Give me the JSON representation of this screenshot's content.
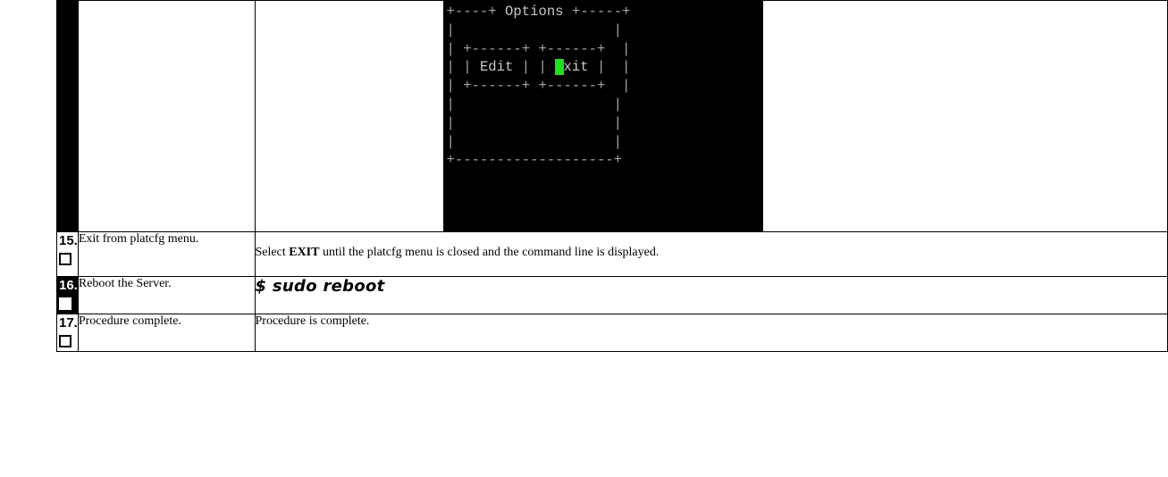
{
  "rows": [
    {
      "step": "",
      "description": "",
      "terminal": {
        "line1_pre": "+----+ ",
        "title": "Options",
        "line1_post": " +-----+",
        "blank": "|                   |",
        "btn_border": "| +------+ +------+  |",
        "btn_line_pre": "| | ",
        "edit_label": "Edit",
        "btn_mid": " | | ",
        "exit_cursor": "E",
        "exit_rest": "xit",
        "btn_line_post": " |  |",
        "bottom": "+-------------------+"
      }
    },
    {
      "step": "15.",
      "description": "Exit from platcfg menu.",
      "body_pre": "Select ",
      "body_bold": "EXIT",
      "body_post": " until the platcfg menu is closed and the command line is displayed."
    },
    {
      "step": "16.",
      "description": "Reboot the Server.",
      "command": "$ sudo reboot"
    },
    {
      "step": "17.",
      "description": "Procedure complete.",
      "body": "Procedure is complete."
    }
  ]
}
